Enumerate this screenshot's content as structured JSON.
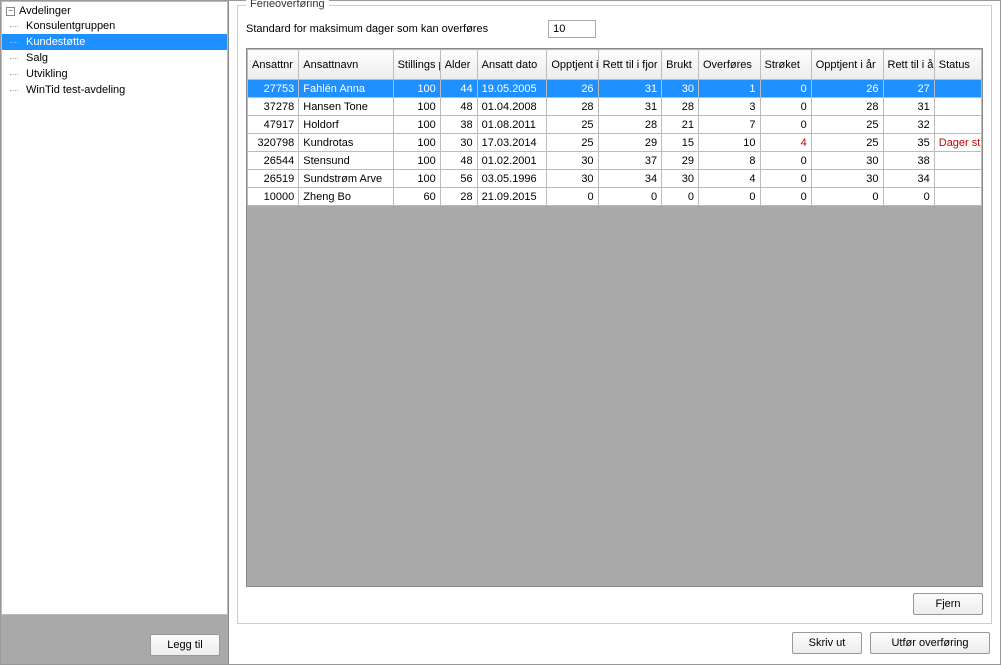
{
  "sidebar": {
    "root": "Avdelinger",
    "items": [
      {
        "label": "Konsulentgruppen"
      },
      {
        "label": "Kundestøtte",
        "selected": true
      },
      {
        "label": "Salg"
      },
      {
        "label": "Utvikling"
      },
      {
        "label": "WinTid test-avdeling"
      }
    ],
    "add_button": "Legg til"
  },
  "panel": {
    "title": "Ferieoverføring",
    "max_days_label": "Standard for maksimum dager som kan overføres",
    "max_days_value": "10",
    "remove_button": "Fjern"
  },
  "footer": {
    "print": "Skriv ut",
    "transfer": "Utfør overføring"
  },
  "columns": [
    "Ansattnr",
    "Ansattnavn",
    "Stillings prosent",
    "Alder",
    "Ansatt dato",
    "Opptjent i fjor",
    "Rett til i fjor",
    "Brukt",
    "Overføres",
    "Strøket",
    "Opptjent i år",
    "Rett til i år",
    "Status"
  ],
  "rows": [
    {
      "selected": true,
      "ansattnr": "27753",
      "navn": "Fahlén Anna",
      "pst": "100",
      "alder": "44",
      "adato": "19.05.2005",
      "opf": "26",
      "rtf": "31",
      "brukt": "30",
      "ovf": "1",
      "str": "0",
      "opa": "26",
      "rta": "27",
      "status": ""
    },
    {
      "selected": false,
      "ansattnr": "37278",
      "navn": "Hansen Tone",
      "pst": "100",
      "alder": "48",
      "adato": "01.04.2008",
      "opf": "28",
      "rtf": "31",
      "brukt": "28",
      "ovf": "3",
      "str": "0",
      "opa": "28",
      "rta": "31",
      "status": ""
    },
    {
      "selected": false,
      "ansattnr": "47917",
      "navn": "Holdorf",
      "pst": "100",
      "alder": "38",
      "adato": "01.08.2011",
      "opf": "25",
      "rtf": "28",
      "brukt": "21",
      "ovf": "7",
      "str": "0",
      "opa": "25",
      "rta": "32",
      "status": ""
    },
    {
      "selected": false,
      "ansattnr": "320798",
      "navn": "Kundrotas",
      "pst": "100",
      "alder": "30",
      "adato": "17.03.2014",
      "opf": "25",
      "rtf": "29",
      "brukt": "15",
      "ovf": "10",
      "str": "4",
      "opa": "25",
      "rta": "35",
      "status": "Dager st",
      "strred": true,
      "statusred": true
    },
    {
      "selected": false,
      "ansattnr": "26544",
      "navn": "Stensund",
      "pst": "100",
      "alder": "48",
      "adato": "01.02.2001",
      "opf": "30",
      "rtf": "37",
      "brukt": "29",
      "ovf": "8",
      "str": "0",
      "opa": "30",
      "rta": "38",
      "status": ""
    },
    {
      "selected": false,
      "ansattnr": "26519",
      "navn": "Sundstrøm Arve",
      "pst": "100",
      "alder": "56",
      "adato": "03.05.1996",
      "opf": "30",
      "rtf": "34",
      "brukt": "30",
      "ovf": "4",
      "str": "0",
      "opa": "30",
      "rta": "34",
      "status": ""
    },
    {
      "selected": false,
      "ansattnr": "10000",
      "navn": "Zheng Bo",
      "pst": "60",
      "alder": "28",
      "adato": "21.09.2015",
      "opf": "0",
      "rtf": "0",
      "brukt": "0",
      "ovf": "0",
      "str": "0",
      "opa": "0",
      "rta": "0",
      "status": ""
    }
  ]
}
